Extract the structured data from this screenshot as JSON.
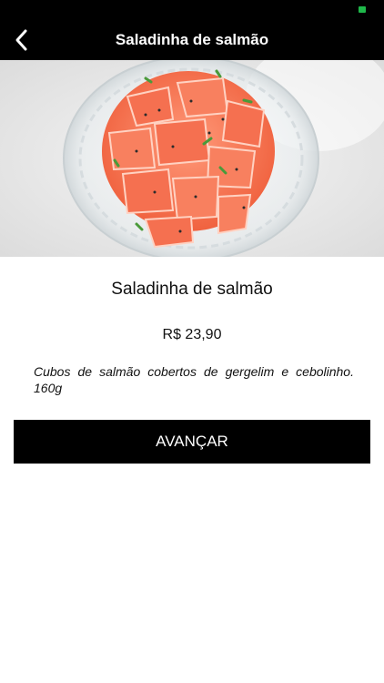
{
  "header": {
    "title": "Saladinha de salmão",
    "back_icon": "chevron-left-icon"
  },
  "product": {
    "name": "Saladinha de salmão",
    "price": "R$ 23,90",
    "description": "Cubos de salmão cobertos de gergelim e cebolinho. 160g"
  },
  "actions": {
    "advance_label": "AVANÇAR"
  },
  "colors": {
    "bar_background": "#000000",
    "button_background": "#000000",
    "battery": "#1fb84a"
  }
}
